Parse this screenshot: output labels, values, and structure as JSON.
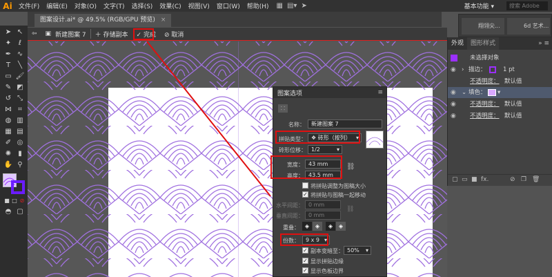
{
  "app": {
    "logo": "Ai"
  },
  "menubar": {
    "items": [
      "文件(F)",
      "编辑(E)",
      "对象(O)",
      "文字(T)",
      "选择(S)",
      "效果(C)",
      "视图(V)",
      "窗口(W)",
      "帮助(H)"
    ],
    "workspace": "基本功能",
    "search_placeholder": "搜索 Adobe"
  },
  "document_tab": {
    "title": "图案设计.ai* @ 49.5% (RGB/GPU 预览)",
    "close": "×"
  },
  "pattern_edit_bar": {
    "pattern_name": "新建图案 7",
    "save_copy": "存储副本",
    "done": "完成",
    "cancel": "取消"
  },
  "floating_panel": {
    "items": [
      "翔翎尖...",
      "6d 艺术..."
    ]
  },
  "appearance_panel": {
    "tabs": [
      "外观",
      "图形样式"
    ],
    "target": "未选择对象",
    "stroke_label": "描边：",
    "stroke_value": "1 pt",
    "opacity1_label": "不透明度：",
    "opacity1_value": "默认值",
    "fill_label": "填色：",
    "opacity2_label": "不透明度：",
    "opacity2_value": "默认值",
    "opacity3_label": "不透明度：",
    "opacity3_value": "默认值",
    "stroke_color": "#9b30ff",
    "fill_color": "#d9a8ff"
  },
  "pattern_options": {
    "title": "图案选项",
    "name_label": "名称：",
    "name_value": "新建图案 7",
    "tile_type_label": "拼贴类型：",
    "tile_type_value": "砖形（按列）",
    "brick_offset_label": "砖形位移：",
    "brick_offset_value": "1/2",
    "width_label": "宽度：",
    "width_value": "43 mm",
    "height_label": "高度：",
    "height_value": "43.5 mm",
    "resize_tile_label": "将拼贴调整为图稿大小",
    "move_tile_label": "将拼贴与图稿一起移动",
    "h_spacing_label": "水平间距：",
    "h_spacing_value": "0 mm",
    "v_spacing_label": "垂直间距：",
    "v_spacing_value": "0 mm",
    "overlap_label": "重叠：",
    "copies_label": "份数：",
    "copies_value": "9 x 9",
    "dim_copies_label": "副本变暗至：",
    "dim_copies_value": "50%",
    "show_tile_edge_label": "显示拼贴边缘",
    "show_swatch_bounds_label": "显示色板边界"
  },
  "colors": {
    "accent": "#e01010",
    "pattern_purple": "#a070e0",
    "pattern_bg": "#575757"
  }
}
